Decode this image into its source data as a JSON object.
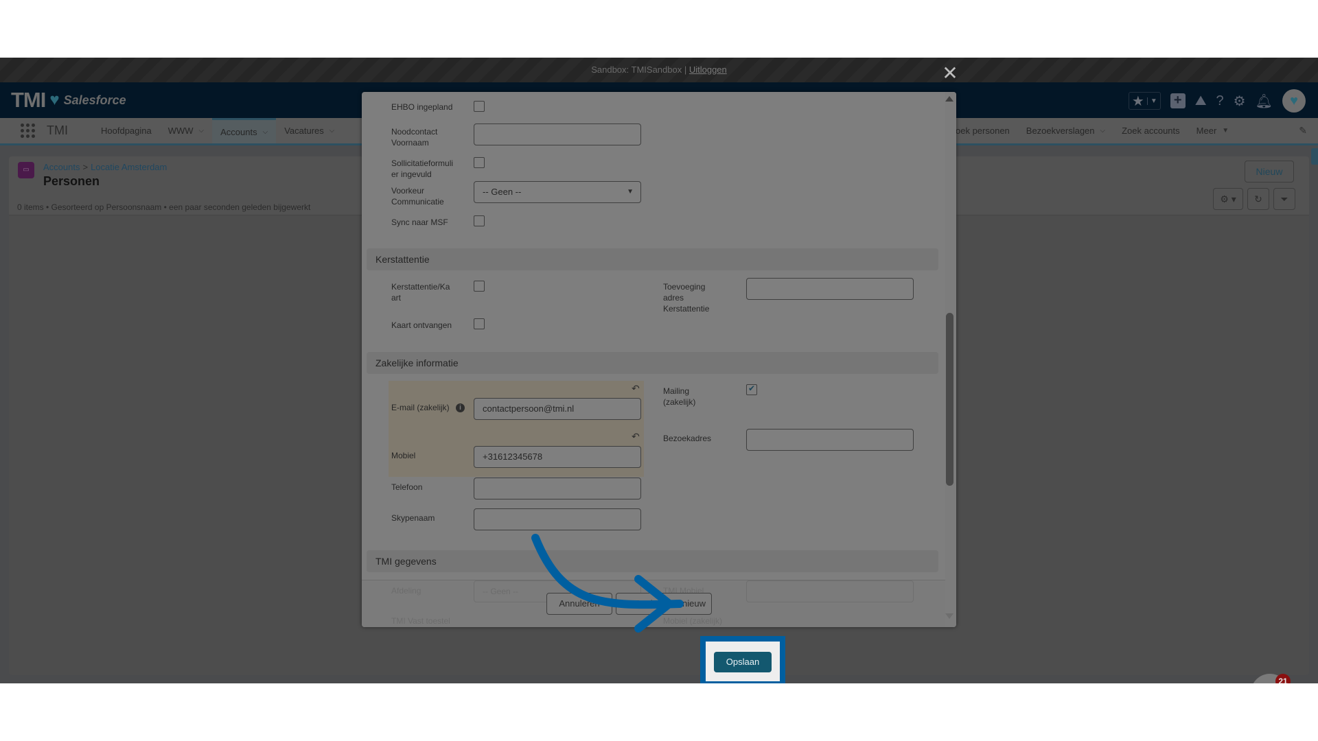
{
  "sandbox_bar": {
    "text": "Sandbox: TMISandbox |",
    "logout_label": "Uitloggen"
  },
  "header": {
    "logo_text": "TMI",
    "logo_product": "Salesforce",
    "icons": [
      "star-icon",
      "chevron-down-icon",
      "add-icon",
      "trailhead-icon",
      "help-icon",
      "settings-icon",
      "bell-icon",
      "avatar"
    ]
  },
  "nav": {
    "app_name": "TMI",
    "items": [
      {
        "label": "Hoofdpagina",
        "has_menu": false,
        "active": false
      },
      {
        "label": "WWW",
        "has_menu": true,
        "active": false
      },
      {
        "label": "Accounts",
        "has_menu": true,
        "active": true
      },
      {
        "label": "Vacatures",
        "has_menu": true,
        "active": false
      }
    ],
    "right_items": [
      {
        "label": "oek personen",
        "has_menu": false
      },
      {
        "label": "Bezoekverslagen",
        "has_menu": true
      },
      {
        "label": "Zoek accounts",
        "has_menu": false
      },
      {
        "label": "Meer",
        "has_menu": true
      }
    ]
  },
  "page": {
    "breadcrumb": [
      "Accounts",
      "Locatie Amsterdam"
    ],
    "breadcrumb_sep": ">",
    "title": "Personen",
    "subtitle": "0 items • Gesorteerd op Persoonsnaam • een paar seconden geleden bijgewerkt",
    "new_button": "Nieuw"
  },
  "modal": {
    "fields_top": [
      {
        "label": "EHBO ingepland",
        "type": "checkbox",
        "checked": false
      },
      {
        "label": "Noodcontact Voornaam",
        "type": "text",
        "value": ""
      },
      {
        "label": "Sollicitatieformulier ingevuld",
        "type": "checkbox",
        "checked": false
      },
      {
        "label": "Voorkeur Communicatie",
        "type": "select",
        "value": "-- Geen --"
      },
      {
        "label": "Sync naar MSF",
        "type": "checkbox",
        "checked": false
      }
    ],
    "section_kerst": {
      "title": "Kerstattentie",
      "kerst_kaart_label": "Kerstattentie/Kaart",
      "kerst_kaart_checked": false,
      "kaart_ontvangen_label": "Kaart ontvangen",
      "kaart_ontvangen_checked": false,
      "toevoeging_label": "Toevoeging adres Kerstattentie",
      "toevoeging_value": ""
    },
    "section_zakelijk": {
      "title": "Zakelijke informatie",
      "email_label": "E-mail (zakelijk)",
      "email_value": "contactpersoon@tmi.nl",
      "mobiel_label": "Mobiel",
      "mobiel_value": "+31612345678",
      "telefoon_label": "Telefoon",
      "telefoon_value": "",
      "skype_label": "Skypenaam",
      "skype_value": "",
      "mailing_label": "Mailing (zakelijk)",
      "mailing_checked": true,
      "bezoekadres_label": "Bezoekadres",
      "bezoekadres_value": ""
    },
    "section_tmi": {
      "title": "TMI gegevens",
      "afdeling_label": "Afdeling",
      "afdeling_value": "-- Geen --",
      "vast_label": "TMI Vast toestel",
      "mobiel_label": "TMI Mobiel",
      "mobiel_zakelijk_label": "Mobiel (zakelijk)"
    },
    "footer": {
      "cancel": "Annuleren",
      "save_new": "Opslaan en nieuw",
      "save": "Opslaan"
    }
  },
  "fab": {
    "badge_count": "21"
  },
  "colors": {
    "highlight": "#005fa0",
    "save_button": "#13586f",
    "arrow": "#005fa0"
  }
}
